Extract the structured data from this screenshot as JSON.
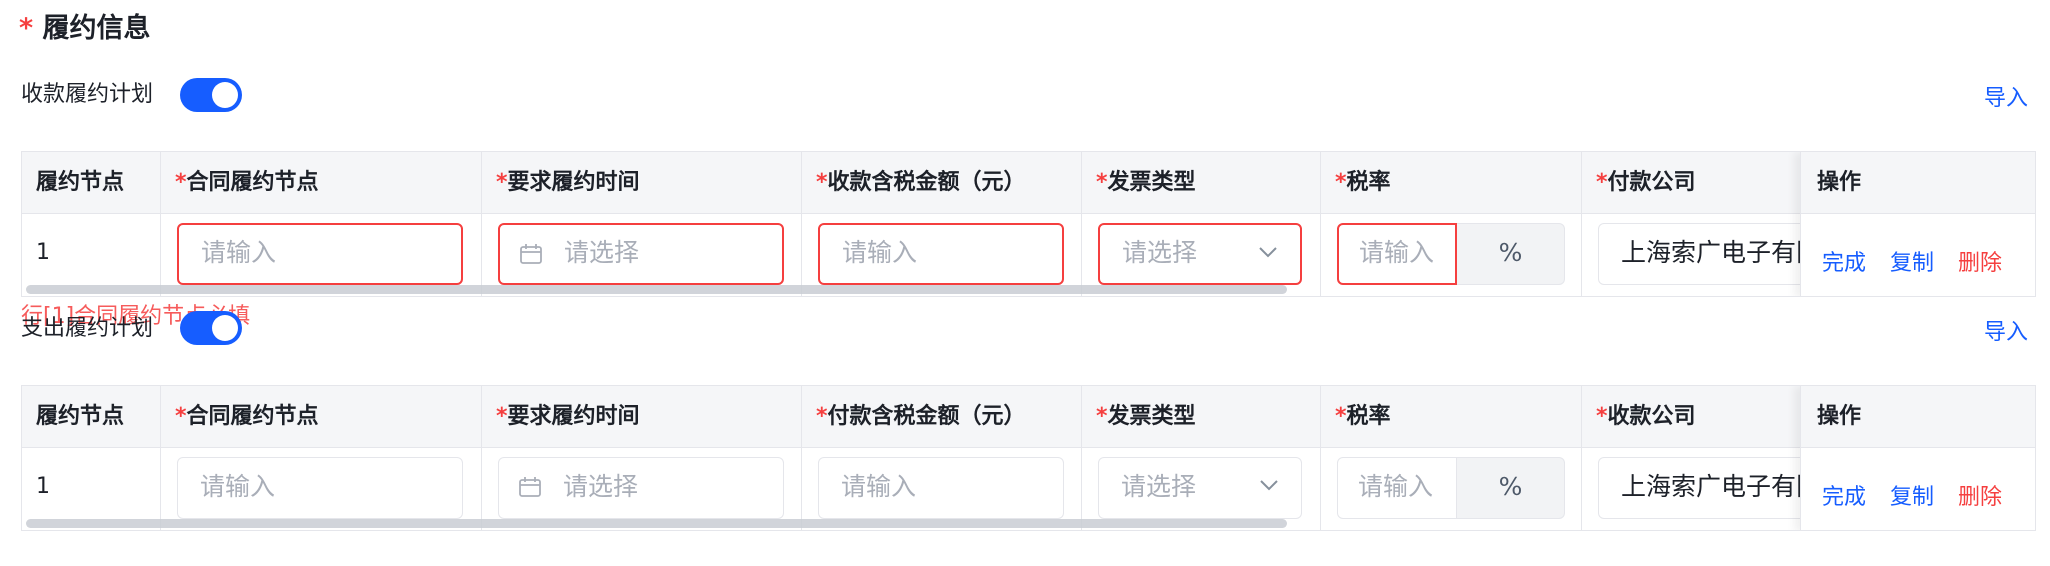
{
  "section": {
    "required_mark": "*",
    "title": "履约信息"
  },
  "receive": {
    "label": "收款履约计划",
    "switch_on": true,
    "import": "导入",
    "headers": [
      "履约节点",
      "合同履约节点",
      "要求履约时间",
      "收款含税金额（元）",
      "发票类型",
      "税率",
      "付款公司",
      "操作"
    ],
    "row": {
      "index": "1",
      "contract_node_placeholder": "请输入",
      "date_placeholder": "请选择",
      "amount_placeholder": "请输入",
      "invoice_placeholder": "请选择",
      "tax_placeholder": "请输入",
      "tax_unit": "%",
      "company_value": "上海索广电子有限公司"
    },
    "error": "行[1]合同履约节点必填"
  },
  "pay": {
    "label": "支出履约计划",
    "switch_on": true,
    "import": "导入",
    "headers": [
      "履约节点",
      "合同履约节点",
      "要求履约时间",
      "付款含税金额（元）",
      "发票类型",
      "税率",
      "收款公司",
      "操作"
    ],
    "row": {
      "index": "1",
      "contract_node_placeholder": "请输入",
      "date_placeholder": "请选择",
      "amount_placeholder": "请输入",
      "invoice_placeholder": "请选择",
      "tax_placeholder": "请输入",
      "tax_unit": "%",
      "company_value": "上海索广电子有限公司"
    }
  },
  "actions": {
    "done": "完成",
    "copy": "复制",
    "delete": "删除"
  },
  "colors": {
    "primary": "#165dff",
    "danger": "#f53f3f",
    "header_bg": "#f5f6f8",
    "border": "#e5e6eb"
  }
}
